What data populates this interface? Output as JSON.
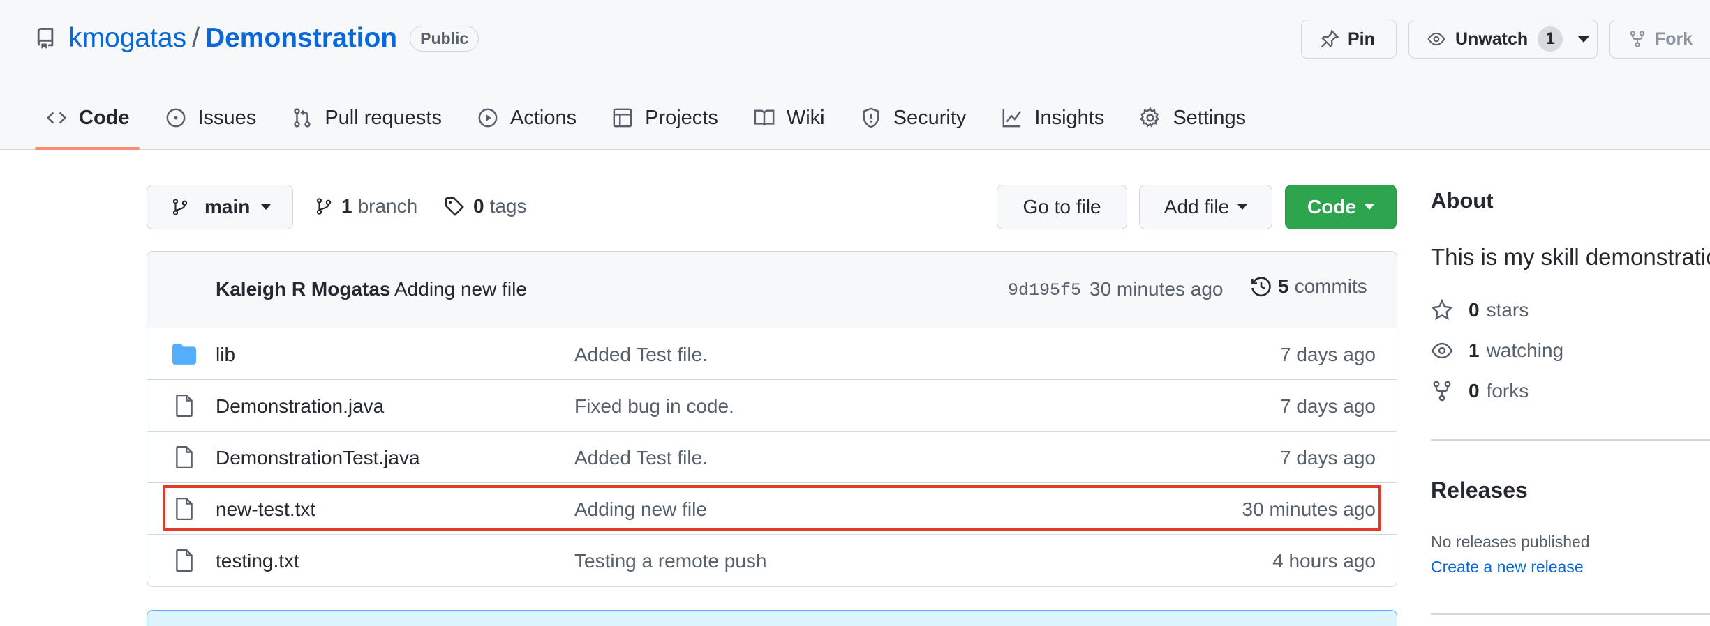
{
  "repo": {
    "owner": "kmogatas",
    "separator": "/",
    "name": "Demonstration",
    "visibility": "Public"
  },
  "header_actions": {
    "pin_label": "Pin",
    "unwatch_label": "Unwatch",
    "watch_count": "1",
    "fork_label": "Fork"
  },
  "tabs": [
    {
      "label": "Code",
      "icon": "code-icon",
      "active": true
    },
    {
      "label": "Issues",
      "icon": "issue-icon"
    },
    {
      "label": "Pull requests",
      "icon": "pull-request-icon"
    },
    {
      "label": "Actions",
      "icon": "play-icon"
    },
    {
      "label": "Projects",
      "icon": "table-icon"
    },
    {
      "label": "Wiki",
      "icon": "book-icon"
    },
    {
      "label": "Security",
      "icon": "shield-icon"
    },
    {
      "label": "Insights",
      "icon": "graph-icon"
    },
    {
      "label": "Settings",
      "icon": "gear-icon"
    }
  ],
  "branch_bar": {
    "current_branch": "main",
    "branch_count": "1",
    "branch_label": "branch",
    "tag_count": "0",
    "tag_label": "tags",
    "go_to_file_label": "Go to file",
    "add_file_label": "Add file",
    "code_label": "Code"
  },
  "latest_commit": {
    "author": "Kaleigh R Mogatas",
    "message": "Adding new file",
    "sha": "9d195f5",
    "time": "30 minutes ago",
    "commit_count": "5",
    "commits_label": "commits"
  },
  "files": [
    {
      "name": "lib",
      "type": "folder",
      "message": "Added Test file.",
      "age": "7 days ago"
    },
    {
      "name": "Demonstration.java",
      "type": "file",
      "message": "Fixed bug in code.",
      "age": "7 days ago"
    },
    {
      "name": "DemonstrationTest.java",
      "type": "file",
      "message": "Added Test file.",
      "age": "7 days ago"
    },
    {
      "name": "new-test.txt",
      "type": "file",
      "message": "Adding new file",
      "age": "30 minutes ago",
      "highlighted": true
    },
    {
      "name": "testing.txt",
      "type": "file",
      "message": "Testing a remote push",
      "age": "4 hours ago"
    }
  ],
  "sidebar": {
    "about_heading": "About",
    "description": "This is my skill demonstration",
    "stars_count": "0",
    "stars_label": "stars",
    "watching_count": "1",
    "watching_label": "watching",
    "forks_count": "0",
    "forks_label": "forks",
    "releases_heading": "Releases",
    "no_releases_text": "No releases published",
    "create_release_link": "Create a new release"
  },
  "colors": {
    "link": "#0969da",
    "code_button": "#2da44e",
    "tab_underline": "#fd8c73",
    "highlight_box": "#e03a2a",
    "folder": "#54aeff"
  }
}
